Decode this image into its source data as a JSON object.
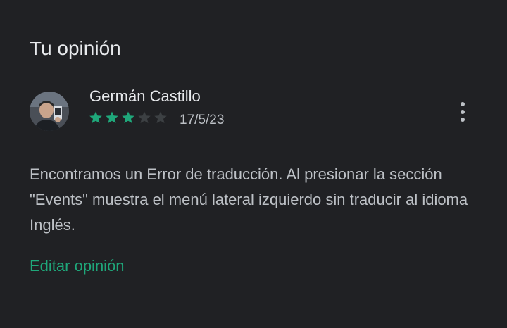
{
  "section": {
    "title": "Tu opinión"
  },
  "review": {
    "author": "Germán Castillo",
    "rating": 3,
    "max_rating": 5,
    "date": "17/5/23",
    "text": "Encontramos un Error de traducción. Al presionar la sección \"Events\" muestra el menú lateral izquierdo sin traducir al idioma Inglés.",
    "avatar_icon": "user-avatar-icon",
    "more_icon": "more-vert-icon"
  },
  "actions": {
    "edit_label": "Editar opinión"
  },
  "colors": {
    "background": "#202124",
    "text_primary": "#e8eaed",
    "text_secondary": "#bdc1c6",
    "accent_green": "#1fa77a",
    "star_filled": "#1fa77a",
    "star_empty": "#3c4043"
  }
}
